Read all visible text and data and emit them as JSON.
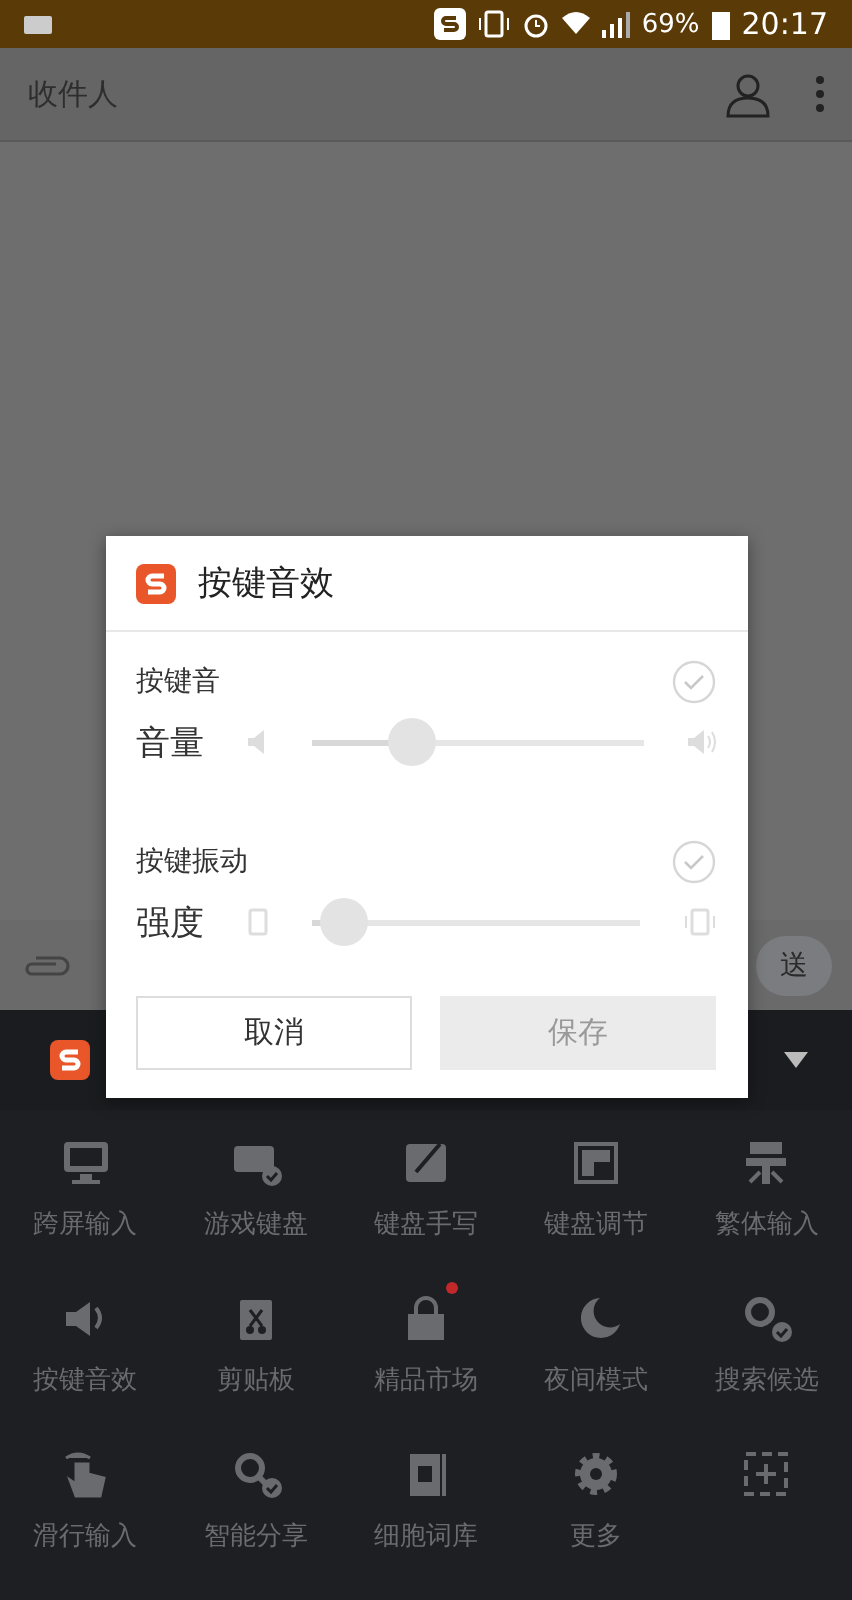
{
  "status_bar": {
    "battery": "69%",
    "time": "20:17"
  },
  "app_bar": {
    "title": "收件人"
  },
  "compose": {
    "send": "送"
  },
  "dialog": {
    "title": "按键音效",
    "sections": [
      {
        "label": "按键音",
        "checked": true,
        "slider_label": "音量",
        "level": 0.3,
        "kind": "sound"
      },
      {
        "label": "按键振动",
        "checked": true,
        "slider_label": "强度",
        "level": 0.1,
        "kind": "vibrate"
      }
    ],
    "buttons": [
      {
        "label": "取消",
        "disabled": false
      },
      {
        "label": "保存",
        "disabled": true
      }
    ]
  },
  "keyboard_menu": {
    "items": [
      {
        "label": "跨屏输入",
        "badge": false
      },
      {
        "label": "游戏键盘",
        "badge": false
      },
      {
        "label": "键盘手写",
        "badge": false
      },
      {
        "label": "键盘调节",
        "badge": false
      },
      {
        "label": "繁体输入",
        "badge": false
      },
      {
        "label": "按键音效",
        "badge": false
      },
      {
        "label": "剪贴板",
        "badge": false
      },
      {
        "label": "精品市场",
        "badge": true
      },
      {
        "label": "夜间模式",
        "badge": false
      },
      {
        "label": "搜索候选",
        "badge": false
      },
      {
        "label": "滑行输入",
        "badge": false
      },
      {
        "label": "智能分享",
        "badge": false
      },
      {
        "label": "细胞词库",
        "badge": false
      },
      {
        "label": "更多",
        "badge": false
      },
      {
        "badge": false
      }
    ]
  }
}
